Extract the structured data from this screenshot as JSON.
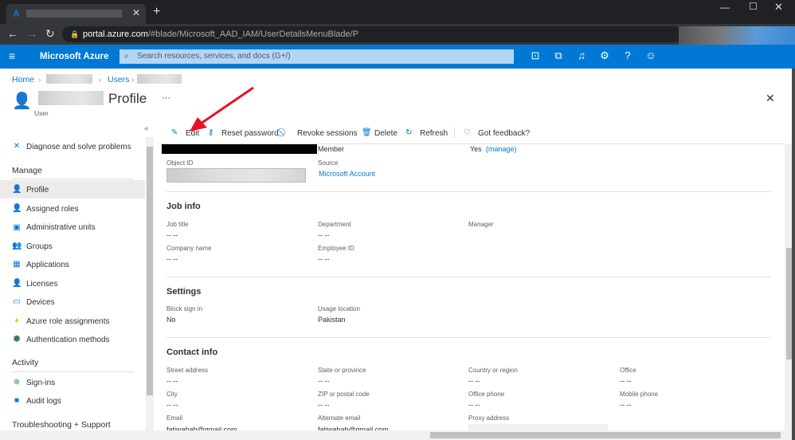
{
  "browser": {
    "url_host": "portal.azure.com",
    "url_path": "/#blade/Microsoft_AAD_IAM/UserDetailsMenuBlade/P"
  },
  "header": {
    "brand": "Microsoft Azure",
    "search_placeholder": "Search resources, services, and docs (G+/)"
  },
  "breadcrumb": {
    "home": "Home",
    "users": "Users"
  },
  "page": {
    "title": "Profile",
    "subtitle": "User",
    "more": "···"
  },
  "toolbar": {
    "edit": "Edit",
    "reset": "Reset password",
    "revoke": "Revoke sessions",
    "delete": "Delete",
    "refresh": "Refresh",
    "feedback": "Got feedback?"
  },
  "sidebar": {
    "diagnose": "Diagnose and solve problems",
    "manage": "Manage",
    "items": [
      "Profile",
      "Assigned roles",
      "Administrative units",
      "Groups",
      "Applications",
      "Licenses",
      "Devices",
      "Azure role assignments",
      "Authentication methods"
    ],
    "activity": "Activity",
    "activity_items": [
      "Sign-ins",
      "Audit logs"
    ],
    "troubleshooting": "Troubleshooting + Support"
  },
  "identity": {
    "member_label": "Member",
    "member_yes": "Yes",
    "manage": "(manage)",
    "object_id_label": "Object ID",
    "source_label": "Source",
    "source_value": "Microsoft Account"
  },
  "job": {
    "title": "Job info",
    "job_title": "Job title",
    "department": "Department",
    "manager": "Manager",
    "company": "Company name",
    "employee_id": "Employee ID",
    "empty": "-- --"
  },
  "settings": {
    "title": "Settings",
    "block_label": "Block sign in",
    "block_value": "No",
    "usage_label": "Usage location",
    "usage_value": "Pakistan"
  },
  "contact": {
    "title": "Contact info",
    "street": "Street address",
    "state": "State or province",
    "country": "Country or region",
    "office": "Office",
    "city": "City",
    "zip": "ZIP or postal code",
    "office_phone": "Office phone",
    "mobile": "Mobile phone",
    "email": "Email",
    "alt_email": "Alternate email",
    "proxy": "Proxy address",
    "email_value": "fatiwahab@gmail.com",
    "alt_email_value": "fatiwahab@gmail.com",
    "empty": "-- --"
  }
}
